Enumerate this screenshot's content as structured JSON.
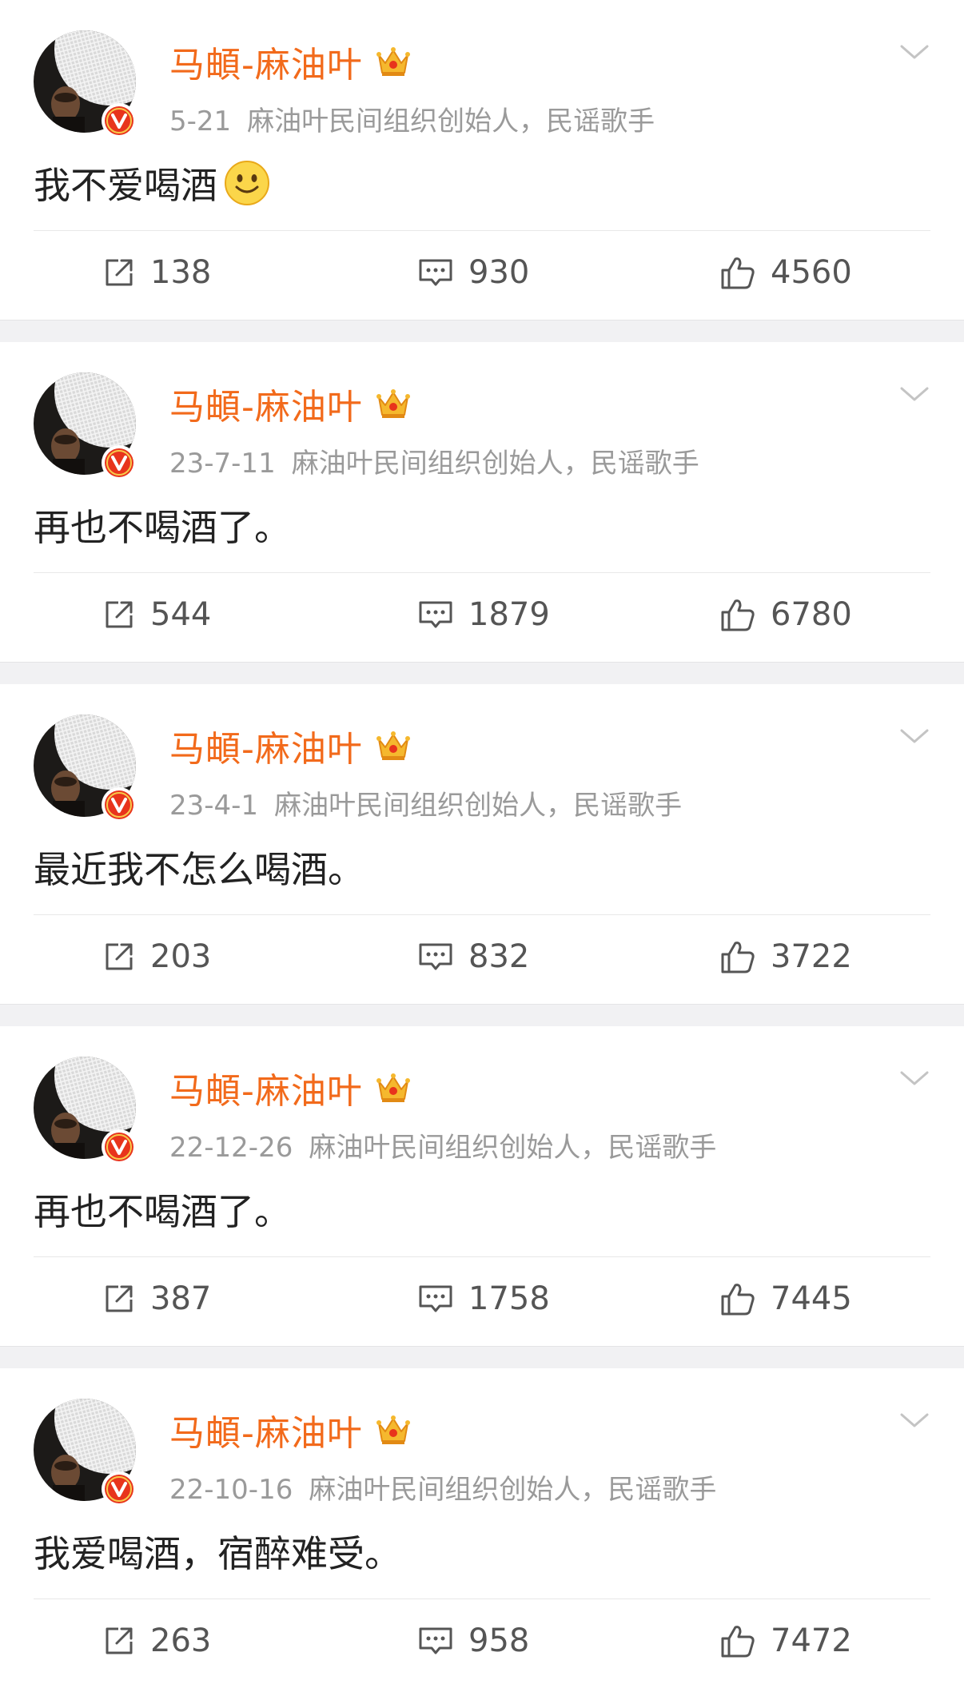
{
  "colors": {
    "name": "#f26a1b",
    "meta": "#9a9a9a",
    "badge": "#e8341c",
    "crown": "#f5b82e",
    "separator": "#f1f1f3"
  },
  "icons": {
    "share": "share-icon",
    "comment": "comment-icon",
    "like": "thumbs-up-icon",
    "verified": "verified-v-badge-icon",
    "member": "crown-icon",
    "menu": "chevron-down-icon",
    "emoji": "smile-emoji-icon"
  },
  "posts": [
    {
      "author": "马頔-麻油叶",
      "date": "5-21",
      "bio": "麻油叶民间组织创始人，民谣歌手",
      "text": "我不爱喝酒",
      "has_emoji": true,
      "shares": "138",
      "comments": "930",
      "likes": "4560"
    },
    {
      "author": "马頔-麻油叶",
      "date": "23-7-11",
      "bio": "麻油叶民间组织创始人，民谣歌手",
      "text": "再也不喝酒了。",
      "has_emoji": false,
      "shares": "544",
      "comments": "1879",
      "likes": "6780"
    },
    {
      "author": "马頔-麻油叶",
      "date": "23-4-1",
      "bio": "麻油叶民间组织创始人，民谣歌手",
      "text": "最近我不怎么喝酒。",
      "has_emoji": false,
      "shares": "203",
      "comments": "832",
      "likes": "3722"
    },
    {
      "author": "马頔-麻油叶",
      "date": "22-12-26",
      "bio": "麻油叶民间组织创始人，民谣歌手",
      "text": "再也不喝酒了。",
      "has_emoji": false,
      "shares": "387",
      "comments": "1758",
      "likes": "7445"
    },
    {
      "author": "马頔-麻油叶",
      "date": "22-10-16",
      "bio": "麻油叶民间组织创始人，民谣歌手",
      "text": "我爱喝酒，宿醉难受。",
      "has_emoji": false,
      "shares": "263",
      "comments": "958",
      "likes": "7472"
    }
  ]
}
